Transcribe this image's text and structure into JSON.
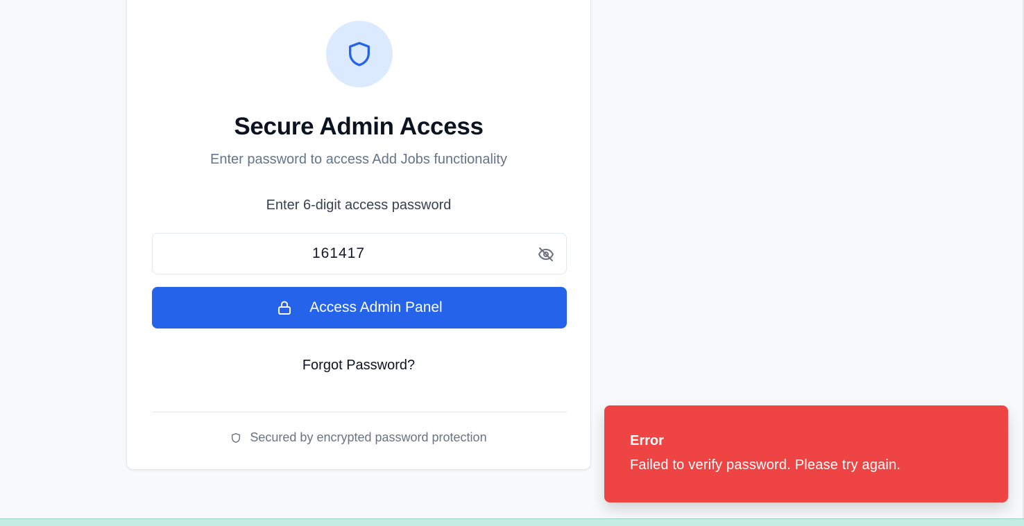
{
  "card": {
    "title": "Secure Admin Access",
    "subtitle": "Enter password to access Add Jobs functionality",
    "field_label": "Enter 6-digit access password",
    "password_value": "161417",
    "submit_label": "Access Admin Panel",
    "forgot_label": "Forgot Password?",
    "footer_note": "Secured by encrypted password protection"
  },
  "toast": {
    "title": "Error",
    "message": "Failed to verify password. Please try again."
  },
  "icons": {
    "header": "shield-icon",
    "visibility": "eye-off-icon",
    "submit": "lock-icon",
    "footer": "shield-icon"
  },
  "colors": {
    "accent": "#2563eb",
    "accent_soft": "#dbeafe",
    "error": "#ef4444"
  }
}
